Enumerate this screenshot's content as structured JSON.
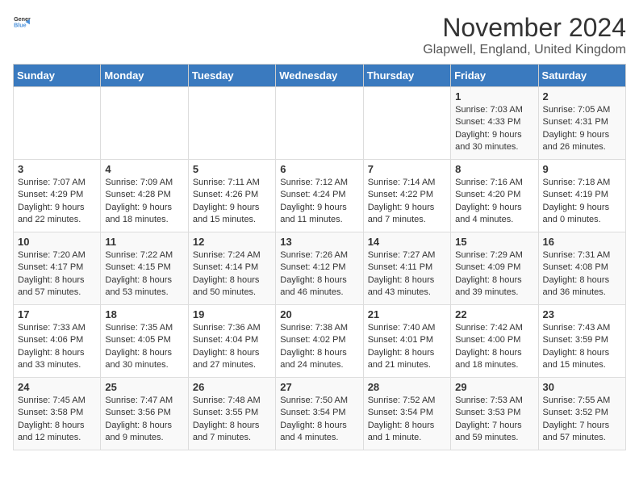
{
  "header": {
    "logo_general": "General",
    "logo_blue": "Blue",
    "month": "November 2024",
    "location": "Glapwell, England, United Kingdom"
  },
  "days_of_week": [
    "Sunday",
    "Monday",
    "Tuesday",
    "Wednesday",
    "Thursday",
    "Friday",
    "Saturday"
  ],
  "weeks": [
    [
      {
        "day": "",
        "info": ""
      },
      {
        "day": "",
        "info": ""
      },
      {
        "day": "",
        "info": ""
      },
      {
        "day": "",
        "info": ""
      },
      {
        "day": "",
        "info": ""
      },
      {
        "day": "1",
        "info": "Sunrise: 7:03 AM\nSunset: 4:33 PM\nDaylight: 9 hours and 30 minutes."
      },
      {
        "day": "2",
        "info": "Sunrise: 7:05 AM\nSunset: 4:31 PM\nDaylight: 9 hours and 26 minutes."
      }
    ],
    [
      {
        "day": "3",
        "info": "Sunrise: 7:07 AM\nSunset: 4:29 PM\nDaylight: 9 hours and 22 minutes."
      },
      {
        "day": "4",
        "info": "Sunrise: 7:09 AM\nSunset: 4:28 PM\nDaylight: 9 hours and 18 minutes."
      },
      {
        "day": "5",
        "info": "Sunrise: 7:11 AM\nSunset: 4:26 PM\nDaylight: 9 hours and 15 minutes."
      },
      {
        "day": "6",
        "info": "Sunrise: 7:12 AM\nSunset: 4:24 PM\nDaylight: 9 hours and 11 minutes."
      },
      {
        "day": "7",
        "info": "Sunrise: 7:14 AM\nSunset: 4:22 PM\nDaylight: 9 hours and 7 minutes."
      },
      {
        "day": "8",
        "info": "Sunrise: 7:16 AM\nSunset: 4:20 PM\nDaylight: 9 hours and 4 minutes."
      },
      {
        "day": "9",
        "info": "Sunrise: 7:18 AM\nSunset: 4:19 PM\nDaylight: 9 hours and 0 minutes."
      }
    ],
    [
      {
        "day": "10",
        "info": "Sunrise: 7:20 AM\nSunset: 4:17 PM\nDaylight: 8 hours and 57 minutes."
      },
      {
        "day": "11",
        "info": "Sunrise: 7:22 AM\nSunset: 4:15 PM\nDaylight: 8 hours and 53 minutes."
      },
      {
        "day": "12",
        "info": "Sunrise: 7:24 AM\nSunset: 4:14 PM\nDaylight: 8 hours and 50 minutes."
      },
      {
        "day": "13",
        "info": "Sunrise: 7:26 AM\nSunset: 4:12 PM\nDaylight: 8 hours and 46 minutes."
      },
      {
        "day": "14",
        "info": "Sunrise: 7:27 AM\nSunset: 4:11 PM\nDaylight: 8 hours and 43 minutes."
      },
      {
        "day": "15",
        "info": "Sunrise: 7:29 AM\nSunset: 4:09 PM\nDaylight: 8 hours and 39 minutes."
      },
      {
        "day": "16",
        "info": "Sunrise: 7:31 AM\nSunset: 4:08 PM\nDaylight: 8 hours and 36 minutes."
      }
    ],
    [
      {
        "day": "17",
        "info": "Sunrise: 7:33 AM\nSunset: 4:06 PM\nDaylight: 8 hours and 33 minutes."
      },
      {
        "day": "18",
        "info": "Sunrise: 7:35 AM\nSunset: 4:05 PM\nDaylight: 8 hours and 30 minutes."
      },
      {
        "day": "19",
        "info": "Sunrise: 7:36 AM\nSunset: 4:04 PM\nDaylight: 8 hours and 27 minutes."
      },
      {
        "day": "20",
        "info": "Sunrise: 7:38 AM\nSunset: 4:02 PM\nDaylight: 8 hours and 24 minutes."
      },
      {
        "day": "21",
        "info": "Sunrise: 7:40 AM\nSunset: 4:01 PM\nDaylight: 8 hours and 21 minutes."
      },
      {
        "day": "22",
        "info": "Sunrise: 7:42 AM\nSunset: 4:00 PM\nDaylight: 8 hours and 18 minutes."
      },
      {
        "day": "23",
        "info": "Sunrise: 7:43 AM\nSunset: 3:59 PM\nDaylight: 8 hours and 15 minutes."
      }
    ],
    [
      {
        "day": "24",
        "info": "Sunrise: 7:45 AM\nSunset: 3:58 PM\nDaylight: 8 hours and 12 minutes."
      },
      {
        "day": "25",
        "info": "Sunrise: 7:47 AM\nSunset: 3:56 PM\nDaylight: 8 hours and 9 minutes."
      },
      {
        "day": "26",
        "info": "Sunrise: 7:48 AM\nSunset: 3:55 PM\nDaylight: 8 hours and 7 minutes."
      },
      {
        "day": "27",
        "info": "Sunrise: 7:50 AM\nSunset: 3:54 PM\nDaylight: 8 hours and 4 minutes."
      },
      {
        "day": "28",
        "info": "Sunrise: 7:52 AM\nSunset: 3:54 PM\nDaylight: 8 hours and 1 minute."
      },
      {
        "day": "29",
        "info": "Sunrise: 7:53 AM\nSunset: 3:53 PM\nDaylight: 7 hours and 59 minutes."
      },
      {
        "day": "30",
        "info": "Sunrise: 7:55 AM\nSunset: 3:52 PM\nDaylight: 7 hours and 57 minutes."
      }
    ]
  ]
}
